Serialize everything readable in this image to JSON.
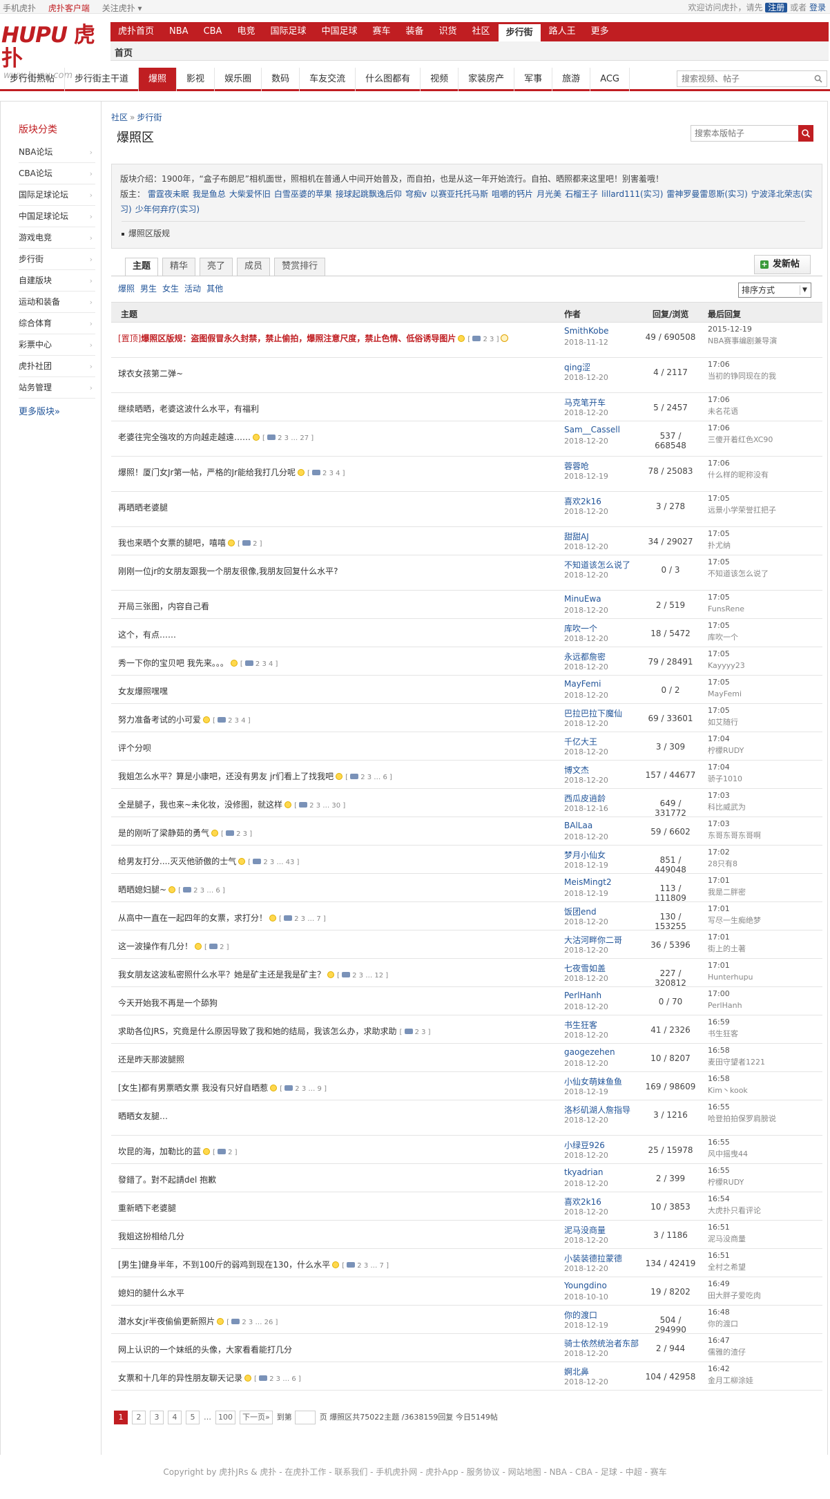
{
  "topbar": {
    "mobile": "手机虎扑",
    "client": "虎扑客户端",
    "follow": "关注虎扑 ▾",
    "welcome": "欢迎访问虎扑，请先",
    "register": "注册",
    "or": "或者",
    "login": "登录"
  },
  "logo": {
    "mark_a": "HUPU",
    "mark_b": "虎扑",
    "url": "www.hupu.com"
  },
  "mainnav": [
    "虎扑首页",
    "NBA",
    "CBA",
    "电竞",
    "国际足球",
    "中国足球",
    "赛车",
    "装备",
    "识货",
    "社区",
    "步行街",
    "路人王",
    "更多"
  ],
  "mainnav_active": "步行街",
  "subnav1": "首页",
  "subnav2": [
    "步行街热帖",
    "步行街主干道",
    "爆照",
    "影视",
    "娱乐圈",
    "数码",
    "车友交流",
    "什么图都有",
    "视频",
    "家装房产",
    "军事",
    "旅游",
    "ACG"
  ],
  "subnav2_active": "爆照",
  "topsearch": {
    "placeholder": "搜索视频、帖子"
  },
  "sidebar": {
    "head": "版块分类",
    "items": [
      "NBA论坛",
      "CBA论坛",
      "国际足球论坛",
      "中国足球论坛",
      "游戏电竞",
      "步行街",
      "自建版块",
      "运动和装备",
      "综合体育",
      "彩票中心",
      "虎扑社团",
      "站务管理"
    ],
    "more": "更多版块»"
  },
  "crumb": {
    "a": "社区",
    "sep": "»",
    "b": "步行街"
  },
  "board": {
    "title": "爆照区",
    "search_placeholder": "搜索本版帖子",
    "intro": "版块介绍：1900年，“盒子布朗尼”相机面世，照相机在普通人中间开始普及，而自拍，也是从这一年开始流行。自拍、晒照都来这里吧！别害羞哦！",
    "mods_label": "版主：",
    "mods": [
      "雷霆夜未眠",
      "我是鱼总",
      "大柴爱怀旧",
      "白雪巫婆的苹果",
      "接球起跳飘逸后仰",
      "穹痴v",
      "以赛亚托托马斯",
      "咀嚼的钙片",
      "月光美",
      "石榴王子",
      "lillard111(实习)",
      "雷神罗曼雷恩斯(实习)",
      "宁波泽北荣志(实习)",
      "少年何弃疗(实习)"
    ],
    "rule": "爆照区版规"
  },
  "tabs": [
    "主题",
    "精华",
    "亮了",
    "成员",
    "赞赏排行"
  ],
  "tabs_active": "主题",
  "newpost": "发新帖",
  "filters": [
    "爆照",
    "男生",
    "女生",
    "活动",
    "其他"
  ],
  "sort": "排序方式",
  "columns": {
    "title": "主题",
    "author": "作者",
    "rv": "回复/浏览",
    "last": "最后回复"
  },
  "posts": [
    {
      "tag": "[置顶]",
      "title": "爆照区版规：盗图假冒永久封禁，禁止偷拍，爆照注意尺度，禁止色情、低俗诱导图片",
      "bulb": true,
      "pages": "2 3",
      "coin": true,
      "author": "SmithKobe",
      "date": "2018-11-12",
      "rv": "49 / 690508",
      "ltime": "2015-12-19",
      "luser": "NBA赛事编剧兼导演"
    },
    {
      "title": "球衣女孩第二弹~",
      "author": "qing涩",
      "date": "2018-12-20",
      "rv": "4 / 2117",
      "ltime": "17:06",
      "luser": "当初的铮同现在的我"
    },
    {
      "title": "继续晒晒，老婆这波什么水平，有福利",
      "author": "马克笔开车",
      "date": "2018-12-20",
      "rv": "5 / 2457",
      "ltime": "17:06",
      "luser": "未名花语"
    },
    {
      "title": "老婆往完全強攻的方向越走越遠……",
      "bulb": true,
      "pages": "2 3 … 27",
      "author": "Sam__Cassell",
      "date": "2018-12-20",
      "rv": "537 / 668548",
      "ltime": "17:06",
      "luser": "三傻开着红色XC90"
    },
    {
      "title": "爆照！厦门女Jr第一帖，严格的Jr能给我打几分呢",
      "bulb": true,
      "pages": "2 3 4",
      "author": "蓉蓉呛",
      "date": "2018-12-19",
      "rv": "78 / 25083",
      "ltime": "17:06",
      "luser": "什么样的昵称没有"
    },
    {
      "title": "再晒晒老婆腿",
      "author": "喜欢2k16",
      "date": "2018-12-20",
      "rv": "3 / 278",
      "ltime": "17:05",
      "luser": "远景小学荣誉扛把子"
    },
    {
      "title": "我也来晒个女票的腿吧，嘻嘻",
      "bulb": true,
      "pages": "2",
      "author": "甜甜AJ",
      "date": "2018-12-20",
      "rv": "34 / 29027",
      "ltime": "17:05",
      "luser": "扑尤纳"
    },
    {
      "title": "刚刚一位jr的女朋友跟我一个朋友很像,我朋友回复什么水平?",
      "author": "不知道该怎么说了",
      "date": "2018-12-20",
      "rv": "0 / 3",
      "ltime": "17:05",
      "luser": "不知道该怎么说了"
    },
    {
      "title": "开局三张图，内容自己看",
      "author": "MinuEwa",
      "date": "2018-12-20",
      "rv": "2 / 519",
      "ltime": "17:05",
      "luser": "FunsRene"
    },
    {
      "title": "这个，有点……",
      "author": "库吹一个",
      "date": "2018-12-20",
      "rv": "18 / 5472",
      "ltime": "17:05",
      "luser": "库吹一个"
    },
    {
      "title": "秀一下你的宝贝吧 我先来。。。",
      "bulb": true,
      "pages": "2 3 4",
      "author": "永远都詹密",
      "date": "2018-12-20",
      "rv": "79 / 28491",
      "ltime": "17:05",
      "luser": "Kayyyy23"
    },
    {
      "title": "女友爆照嘿嘿",
      "author": "MayFemi",
      "date": "2018-12-20",
      "rv": "0 / 2",
      "ltime": "17:05",
      "luser": "MayFemi"
    },
    {
      "title": "努力准备考试的小可爱",
      "bulb": true,
      "pages": "2 3 4",
      "author": "巴拉巴拉下魔仙",
      "date": "2018-12-20",
      "rv": "69 / 33601",
      "ltime": "17:05",
      "luser": "如艾随行"
    },
    {
      "title": "评个分呗",
      "author": "千亿大王",
      "date": "2018-12-20",
      "rv": "3 / 309",
      "ltime": "17:04",
      "luser": "柠檬RUDY"
    },
    {
      "title": "我姐怎么水平？算是小康吧，还没有男友 jr们看上了找我吧",
      "bulb": true,
      "pages": "2 3 … 6",
      "author": "博文杰",
      "date": "2018-12-20",
      "rv": "157 / 44677",
      "ltime": "17:04",
      "luser": "骄子1010"
    },
    {
      "title": "全是腿子，我也来~未化妆，没修图，就这样",
      "bulb": true,
      "pages": "2 3 … 30",
      "author": "西瓜皮逍龄",
      "date": "2018-12-16",
      "rv": "649 / 331772",
      "ltime": "17:03",
      "luser": "科比威武为"
    },
    {
      "title": "是的刚听了梁静茹的勇气",
      "bulb": true,
      "pages": "2 3",
      "author": "BAlLaa",
      "date": "2018-12-20",
      "rv": "59 / 6602",
      "ltime": "17:03",
      "luser": "东哥东哥东哥啊"
    },
    {
      "title": "给男友打分....灭灭他骄傲的士气",
      "bulb": true,
      "pages": "2 3 … 43",
      "author": "梦月小仙女",
      "date": "2018-12-19",
      "rv": "851 / 449048",
      "ltime": "17:02",
      "luser": "28只有8"
    },
    {
      "title": "晒晒媳妇腿~",
      "bulb": true,
      "pages": "2 3 … 6",
      "author": "MeisMingt2",
      "date": "2018-12-19",
      "rv": "113 / 111809",
      "ltime": "17:01",
      "luser": "我是二胖密"
    },
    {
      "title": "从高中一直在一起四年的女票，求打分！",
      "bulb": true,
      "pages": "2 3 … 7",
      "author": "饭团end",
      "date": "2018-12-20",
      "rv": "130 / 153255",
      "ltime": "17:01",
      "luser": "写尽一生痴绝梦"
    },
    {
      "title": "这一波操作有几分！",
      "bulb": true,
      "pages": "2",
      "author": "大沽河畔你二哥",
      "date": "2018-12-20",
      "rv": "36 / 5396",
      "ltime": "17:01",
      "luser": "街上的土著"
    },
    {
      "title": "我女朋友这波私密照什么水平？她是矿主还是我是矿主？",
      "bulb": true,
      "pages": "2 3 … 12",
      "author": "七夜雪如盖",
      "date": "2018-12-20",
      "rv": "227 / 320812",
      "ltime": "17:01",
      "luser": "Hunterhupu"
    },
    {
      "title": "今天开始我不再是一个舔狗",
      "author": "PerlHanh",
      "date": "2018-12-20",
      "rv": "0 / 70",
      "ltime": "17:00",
      "luser": "PerlHanh"
    },
    {
      "title": "求助各位JRS，究竟是什么原因导致了我和她的结局，我该怎么办，求助求助",
      "pages": "2 3",
      "author": "书生狂客",
      "date": "2018-12-20",
      "rv": "41 / 2326",
      "ltime": "16:59",
      "luser": "书生狂客"
    },
    {
      "title": "还是昨天那波腿照",
      "author": "gaogezehen",
      "date": "2018-12-20",
      "rv": "10 / 8207",
      "ltime": "16:58",
      "luser": "麦田守望者1221"
    },
    {
      "title": "[女生]都有男票晒女票 我没有只好自晒惹",
      "bulb": true,
      "pages": "2 3 … 9",
      "author": "小仙女萌妹鱼鱼",
      "date": "2018-12-19",
      "rv": "169 / 98609",
      "ltime": "16:58",
      "luser": "Kim丶kook"
    },
    {
      "title": "晒晒女友腿…",
      "author": "洛杉矶湖人詹指导",
      "date": "2018-12-20",
      "rv": "3 / 1216",
      "ltime": "16:55",
      "luser": "哈登拍拍保罗肩膀说"
    },
    {
      "title": "坎昆的海，加勒比的蓝",
      "bulb": true,
      "pages": "2",
      "author": "小绿豆926",
      "date": "2018-12-20",
      "rv": "25 / 15978",
      "ltime": "16:55",
      "luser": "风中摇曳44"
    },
    {
      "title": "發錯了。對不起請del 抱歉",
      "author": "tkyadrian",
      "date": "2018-12-20",
      "rv": "2 / 399",
      "ltime": "16:55",
      "luser": "柠檬RUDY"
    },
    {
      "title": "重新晒下老婆腿",
      "author": "喜欢2k16",
      "date": "2018-12-20",
      "rv": "10 / 3853",
      "ltime": "16:54",
      "luser": "大虎扑只看评论"
    },
    {
      "title": "我姐这扮相给几分",
      "author": "泥马没商量",
      "date": "2018-12-20",
      "rv": "3 / 1186",
      "ltime": "16:51",
      "luser": "泥马没商量"
    },
    {
      "title": "[男生]健身半年，不到100斤的弱鸡到现在130，什么水平",
      "bulb": true,
      "pages": "2 3 … 7",
      "author": "小装装德拉蒙德",
      "date": "2018-12-20",
      "rv": "134 / 42419",
      "ltime": "16:51",
      "luser": "全村之希望"
    },
    {
      "title": "媳妇的腿什么水平",
      "author": "Youngdino",
      "date": "2018-10-10",
      "rv": "19 / 8202",
      "ltime": "16:49",
      "luser": "田大胖子爱吃肉"
    },
    {
      "title": "潜水女jr半夜偷偷更新照片",
      "bulb": true,
      "pages": "2 3 … 26",
      "author": "你的渡口",
      "date": "2018-12-19",
      "rv": "504 / 294990",
      "ltime": "16:48",
      "luser": "你的渡口"
    },
    {
      "title": "网上认识的一个妹纸的头像，大家看看能打几分",
      "author": "骑士依然统治者东部",
      "date": "2018-12-20",
      "rv": "2 / 944",
      "ltime": "16:47",
      "luser": "儒雅的渣仔"
    },
    {
      "title": "女票和十几年的异性朋友聊天记录",
      "bulb": true,
      "pages": "2 3 … 6",
      "author": "婀北鼻",
      "date": "2018-12-20",
      "rv": "104 / 42958",
      "ltime": "16:42",
      "luser": "金月工柳涂娃"
    }
  ],
  "pager": {
    "pages": [
      "1",
      "2",
      "3",
      "4",
      "5"
    ],
    "dots": "…",
    "last": "100",
    "next": "下一页»",
    "goto": "到第",
    "stats": "页 爆照区共75022主题 /3638159回复 今日5149帖"
  },
  "footer": "Copyright by 虎扑JRs & 虎扑 - 在虎扑工作 - 联系我们 - 手机虎扑网 - 虎扑App - 服务协议 - 网站地图 - NBA - CBA - 足球 - 中超 - 赛车",
  "colors": {
    "brand": "#c01e22",
    "link": "#225599"
  }
}
